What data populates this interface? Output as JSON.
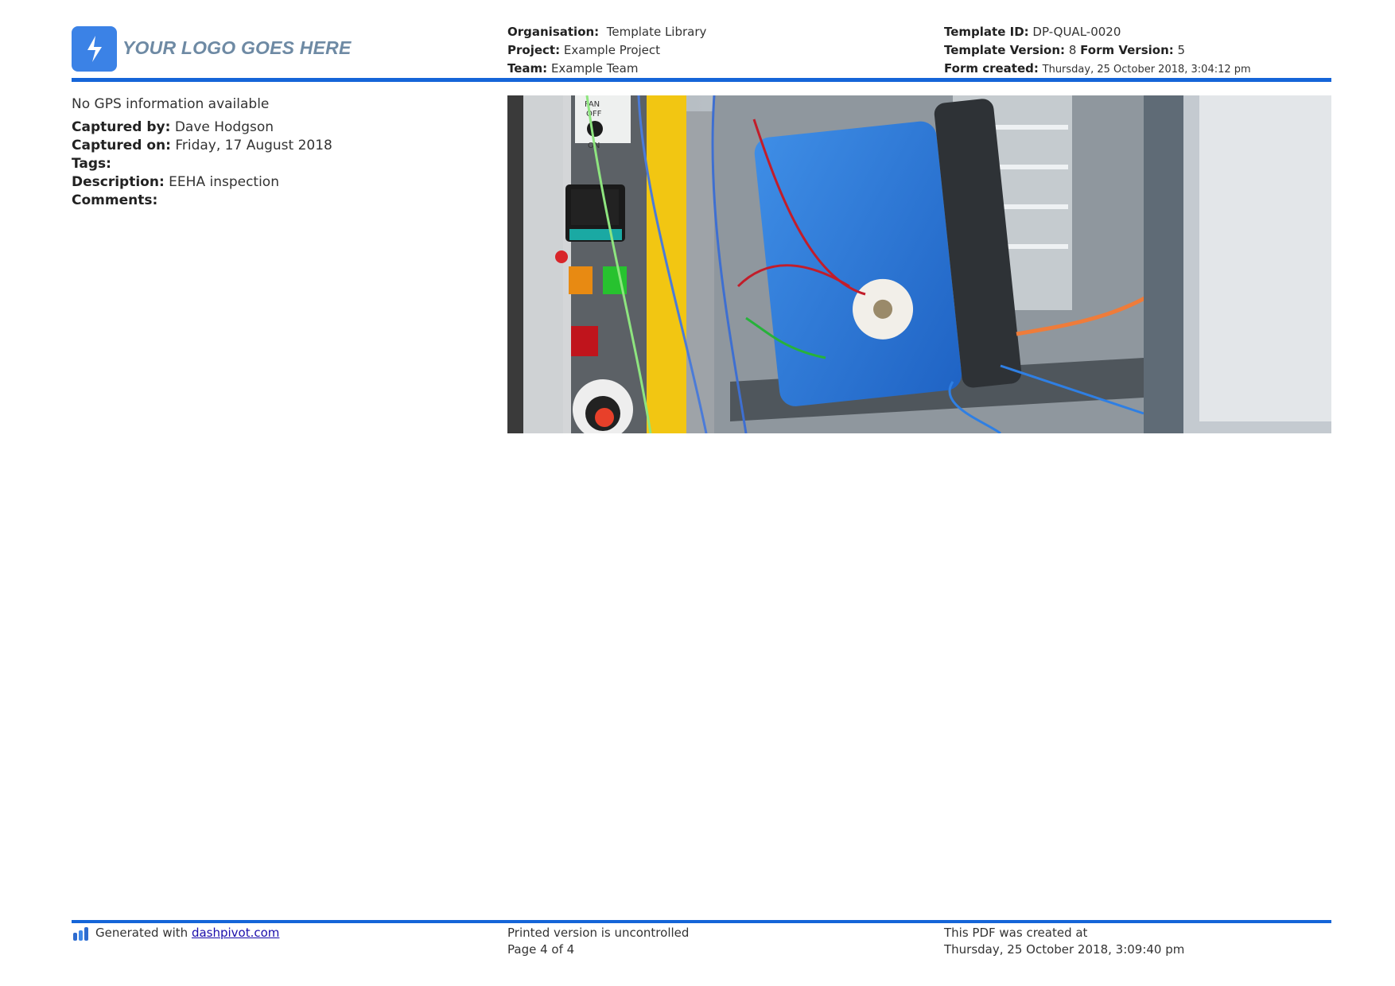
{
  "header": {
    "logo_text": "YOUR LOGO GOES HERE",
    "organisation_label": "Organisation:",
    "organisation_value": "Template Library",
    "project_label": "Project:",
    "project_value": "Example Project",
    "team_label": "Team:",
    "team_value": "Example Team",
    "template_id_label": "Template ID:",
    "template_id_value": "DP-QUAL-0020",
    "template_version_label": "Template Version:",
    "template_version_value": "8",
    "form_version_label": "Form Version:",
    "form_version_value": "5",
    "form_created_label": "Form created:",
    "form_created_value": "Thursday, 25 October 2018, 3:04:12 pm",
    "accent_color": "#1565d8"
  },
  "photo_details": {
    "gps": "No GPS information available",
    "captured_by_label": "Captured by:",
    "captured_by_value": "Dave Hodgson",
    "captured_on_label": "Captured on:",
    "captured_on_value": "Friday, 17 August 2018",
    "tags_label": "Tags:",
    "tags_value": "",
    "description_label": "Description:",
    "description_value": "EEHA inspection",
    "comments_label": "Comments:",
    "comments_value": ""
  },
  "photo": {
    "knob_top": "FAN",
    "knob_off": "OFF",
    "knob_on": "ON"
  },
  "footer": {
    "generated_prefix": "Generated with",
    "generated_link": "dashpivot.com",
    "uncontrolled": "Printed version is uncontrolled",
    "page": "Page 4 of 4",
    "created_label": "This PDF was created at",
    "created_value": "Thursday, 25 October 2018, 3:09:40 pm"
  }
}
